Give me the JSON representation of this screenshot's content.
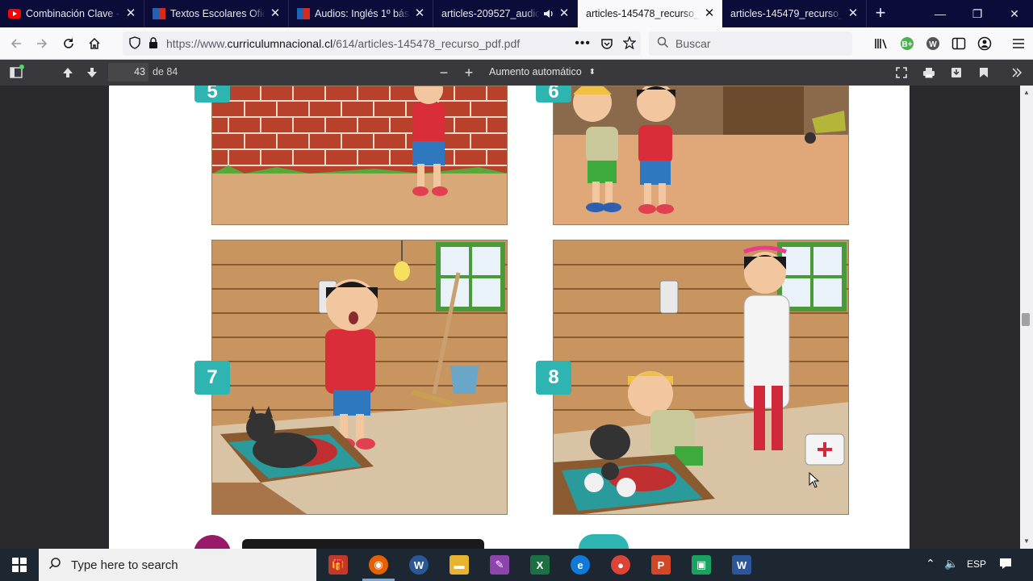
{
  "tabs": [
    {
      "title": "Combinación Clave - ",
      "favicon_color": "#ff0000"
    },
    {
      "title": "Textos Escolares Ofici",
      "favicon_color": "#1e63b4"
    },
    {
      "title": "Audios: Inglés 1º básic",
      "favicon_color": "#1e63b4"
    },
    {
      "title": "articles-209527_audio",
      "favicon_color": "none"
    },
    {
      "title": "articles-145478_recurso_p",
      "favicon_color": "none",
      "active": true
    },
    {
      "title": "articles-145479_recurso_p",
      "favicon_color": "none"
    }
  ],
  "address": {
    "prefix": "https://www.",
    "domain": "curriculumnacional.cl",
    "path": "/614/articles-145478_recurso_pdf.pdf"
  },
  "search": {
    "placeholder": "Buscar"
  },
  "pdf_toolbar": {
    "page_number": "43",
    "page_count": "de 84",
    "zoom": "Aumento automático"
  },
  "page_content": {
    "badges": [
      "5",
      "6",
      "7",
      "8"
    ]
  },
  "taskbar": {
    "search_placeholder": "Type here to search",
    "language": "ESP"
  },
  "colors": {
    "tabbar_bg": "#0c0c3a",
    "pdf_toolbar_bg": "#38383d",
    "badge_teal": "#2fb5b1",
    "taskbar_bg": "#1d2731"
  }
}
